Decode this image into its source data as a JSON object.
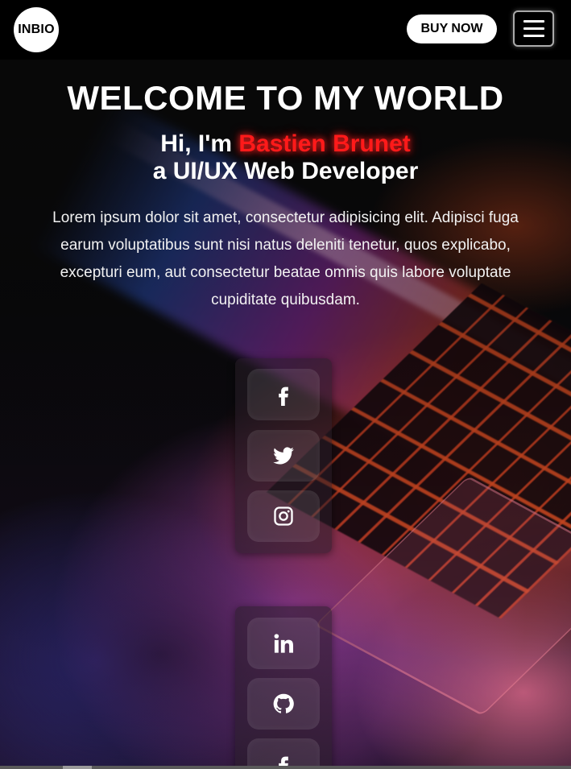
{
  "navbar": {
    "logo_text": "INBIO",
    "buy_label": "BUY NOW",
    "menu_icon": "hamburger-menu-icon"
  },
  "hero": {
    "welcome": "WELCOME TO MY WORLD",
    "greeting_prefix": "Hi, I'm ",
    "name": "Bastien Brunet",
    "role": "a UI/UX Web Developer",
    "intro": "Lorem ipsum dolor sit amet, consectetur adipisicing elit. Adipisci fuga earum voluptatibus sunt nisi natus deleniti tenetur, quos explicabo, excepturi eum, aut consectetur beatae omnis quis labore voluptate cupiditate quibusdam.",
    "name_color": "#ff1a1a"
  },
  "social": {
    "panel_1": [
      "facebook-icon",
      "twitter-icon",
      "instagram-icon"
    ],
    "panel_2": [
      "linkedin-icon",
      "github-icon",
      "facebook-icon"
    ]
  }
}
